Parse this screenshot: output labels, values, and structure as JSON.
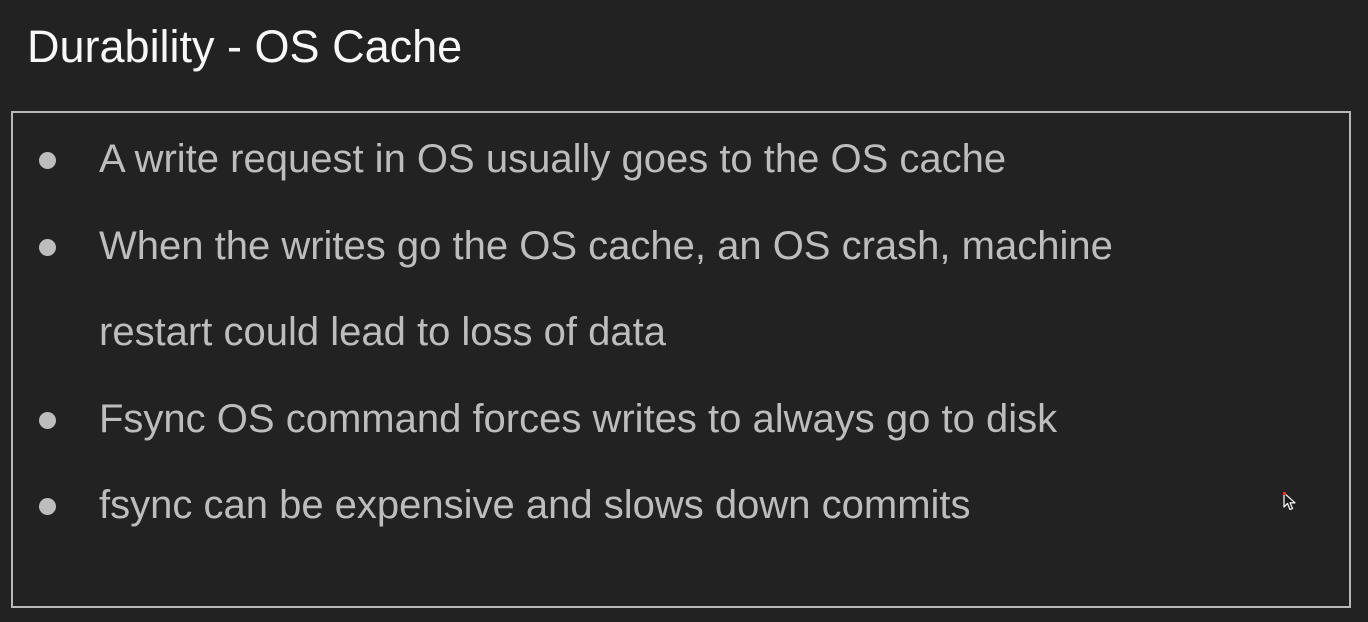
{
  "slide": {
    "title": "Durability - OS Cache",
    "bullets": [
      {
        "lines": [
          "A write request in OS usually goes to the OS cache"
        ]
      },
      {
        "lines": [
          "When the writes go the OS cache, an OS crash, machine",
          "restart could lead to loss of data"
        ]
      },
      {
        "lines": [
          "Fsync OS command forces writes to always go to disk"
        ]
      },
      {
        "lines": [
          "fsync can be expensive and slows down commits"
        ]
      }
    ]
  },
  "icons": {
    "bullet": "bullet-dot-icon",
    "cursor": "mouse-pointer-icon"
  },
  "colors": {
    "background": "#222222",
    "title": "#f7f7f7",
    "body_text": "#bdbdbd",
    "box_border": "#b8b8b8",
    "cursor_accent": "#e03030"
  }
}
